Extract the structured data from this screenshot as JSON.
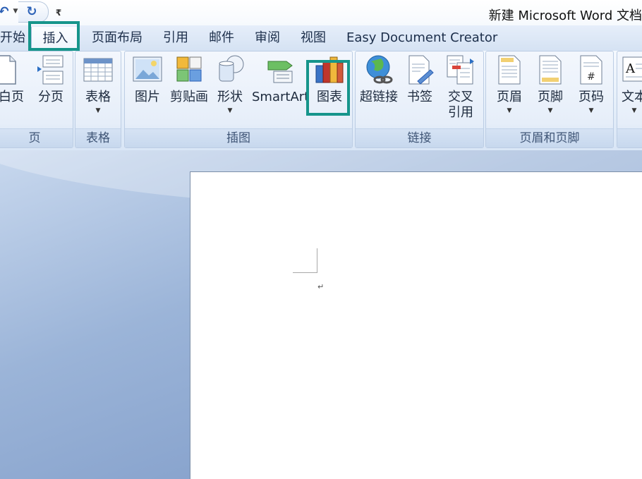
{
  "window": {
    "title": "新建 Microsoft Word 文档",
    "quick_access": {
      "customize_glyph": "₹"
    }
  },
  "tabs": [
    {
      "label": "开始"
    },
    {
      "label": "插入",
      "active": true
    },
    {
      "label": "页面布局"
    },
    {
      "label": "引用"
    },
    {
      "label": "邮件"
    },
    {
      "label": "审阅"
    },
    {
      "label": "视图"
    },
    {
      "label": "Easy Document Creator"
    }
  ],
  "ribbon": {
    "groups": {
      "pages": {
        "label": "页",
        "buttons": {
          "blank_page": "空白页",
          "page_break": "分页"
        }
      },
      "tables": {
        "label": "表格",
        "buttons": {
          "table": "表格"
        }
      },
      "illustrations": {
        "label": "插图",
        "buttons": {
          "picture": "图片",
          "clipart": "剪贴画",
          "shapes": "形状",
          "smartart": "SmartArt",
          "chart": "图表"
        }
      },
      "links": {
        "label": "链接",
        "buttons": {
          "hyperlink": "超链接",
          "bookmark": "书签",
          "cross_ref_1": "交叉",
          "cross_ref_2": "引用"
        }
      },
      "header_footer": {
        "label": "页眉和页脚",
        "buttons": {
          "header": "页眉",
          "footer": "页脚",
          "page_number": "页码"
        }
      },
      "text": {
        "buttons": {
          "textbox": "文本"
        }
      }
    }
  },
  "document": {
    "paragraph_mark": "↵"
  },
  "colors": {
    "highlight": "#16958b",
    "accent_blue": "#2b5fb4"
  }
}
